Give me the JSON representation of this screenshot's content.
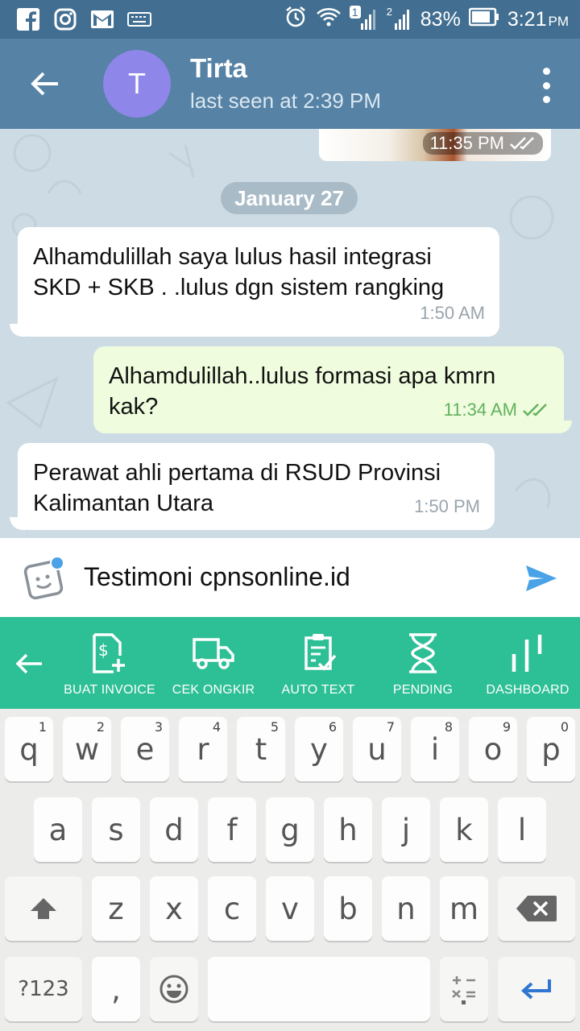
{
  "status_bar": {
    "battery": "83%",
    "time": "3:21",
    "time_suffix": "PM",
    "sim1_badge": "1",
    "sim2_badge": "2"
  },
  "header": {
    "avatar_letter": "T",
    "contact_name": "Tirta",
    "last_seen": "last seen at 2:39 PM"
  },
  "chat": {
    "photo_time": "11:35 PM",
    "date_separator": "January 27",
    "messages": [
      {
        "direction": "incoming",
        "text": "Alhamdulillah saya lulus hasil integrasi\nSKD + SKB . .lulus dgn sistem rangking",
        "time": "1:50 AM"
      },
      {
        "direction": "outgoing",
        "text": "Alhamdulillah..lulus formasi apa kmrn\nkak?",
        "time": "11:34 AM"
      },
      {
        "direction": "incoming",
        "text": "Perawat ahli pertama di RSUD Provinsi\nKalimantan Utara",
        "time": "1:50 PM"
      }
    ]
  },
  "input": {
    "value": "Testimoni cpnsonline.id"
  },
  "toolbar": {
    "items": [
      {
        "label": "BUAT INVOICE",
        "icon": "invoice-icon"
      },
      {
        "label": "CEK ONGKIR",
        "icon": "truck-icon"
      },
      {
        "label": "AUTO TEXT",
        "icon": "clipboard-check-icon"
      },
      {
        "label": "PENDING",
        "icon": "hourglass-icon"
      },
      {
        "label": "DASHBOARD",
        "icon": "bars-icon"
      }
    ]
  },
  "keyboard": {
    "row1": [
      "q",
      "w",
      "e",
      "r",
      "t",
      "y",
      "u",
      "i",
      "o",
      "p"
    ],
    "row1_hints": [
      "1",
      "2",
      "3",
      "4",
      "5",
      "6",
      "7",
      "8",
      "9",
      "0"
    ],
    "row2": [
      "a",
      "s",
      "d",
      "f",
      "g",
      "h",
      "j",
      "k",
      "l"
    ],
    "row3": [
      "z",
      "x",
      "c",
      "v",
      "b",
      "n",
      "m"
    ],
    "symbols_key": "?123",
    "comma_key": ","
  },
  "colors": {
    "app_bar": "#5582a5",
    "status_bar": "#426f91",
    "toolbar": "#2dbf95",
    "avatar": "#8e86e8",
    "outgoing_bubble": "#effdde"
  }
}
